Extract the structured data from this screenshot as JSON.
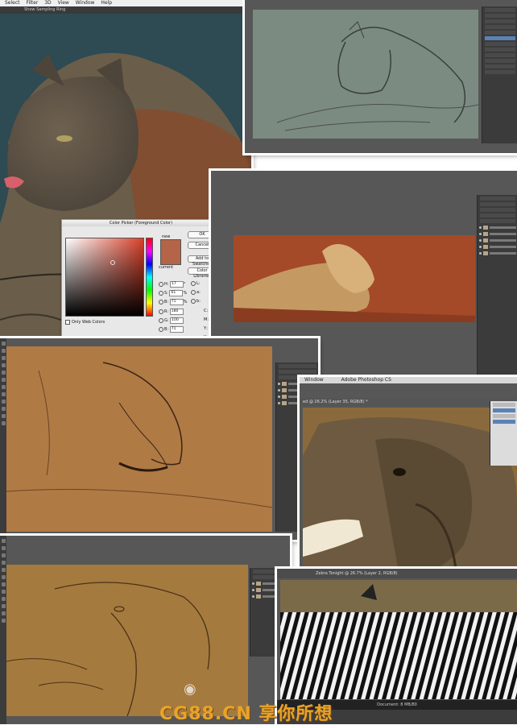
{
  "shot1": {
    "menu": [
      "Select",
      "Filter",
      "3D",
      "View",
      "Window",
      "Help"
    ],
    "option": "Show Sampling Ring"
  },
  "color_picker": {
    "title": "Color Picker (Foreground Color)",
    "new_label": "new",
    "current_label": "current",
    "ok": "OK",
    "cancel": "Cancel",
    "add_swatches": "Add to Swatches",
    "color_libraries": "Color Libraries",
    "only_web": "Only Web Colors",
    "fields": [
      {
        "k": "H",
        "v": "17",
        "u": "°"
      },
      {
        "k": "S",
        "v": "61",
        "u": "%"
      },
      {
        "k": "B",
        "v": "71",
        "u": "%"
      },
      {
        "k": "R",
        "v": "180",
        "u": ""
      },
      {
        "k": "G",
        "v": "100",
        "u": ""
      },
      {
        "k": "B",
        "v": "71",
        "u": ""
      }
    ],
    "lab_fields": [
      "L",
      "a",
      "b",
      "C",
      "M",
      "Y",
      "K"
    ],
    "hex": "b46547",
    "selected_color": "#b46547"
  },
  "shot5": {
    "menu": "Window",
    "app_title": "Adobe Photoshop CS",
    "doc_tab": "ed @ 26.2% (Layer 35, RGB/8) *"
  },
  "shot6": {
    "doc_tab": "Zebra Tonight @ 26.7% (Layer 2, RGB/8)",
    "status": "Document: 8 MB/80"
  },
  "watermark": {
    "text": "CG88.CN 享你所想"
  },
  "colors": {
    "ps_gray": "#575757",
    "panel": "#3b3b3b",
    "teal_canvas": "#2e4a52",
    "gray_green_canvas": "#7c8b82",
    "rust_canvas": "#a44a28",
    "tan_canvas": "#b07a45",
    "brown_canvas": "#8a6a3c",
    "watermark": "#e8a42a"
  }
}
